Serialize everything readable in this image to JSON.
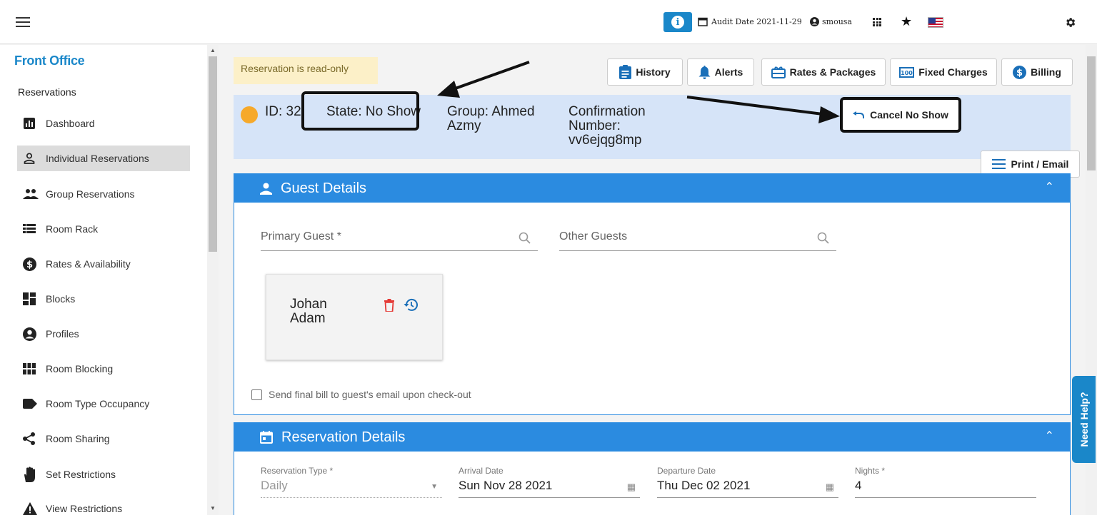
{
  "topbar": {
    "audit_label": "Audit Date 2021-11-29",
    "username": "smousa",
    "info_icon": "info-icon",
    "apps_icon": "apps-grid-icon",
    "favorites_icon": "star-icon",
    "language_icon": "us-flag-icon",
    "settings_icon": "gear-icon"
  },
  "sidebar": {
    "title": "Front Office",
    "section": "Reservations",
    "items": [
      {
        "label": "Dashboard",
        "icon": "dashboard-icon"
      },
      {
        "label": "Individual Reservations",
        "icon": "person-icon",
        "active": true
      },
      {
        "label": "Group Reservations",
        "icon": "group-icon"
      },
      {
        "label": "Room Rack",
        "icon": "list-icon"
      },
      {
        "label": "Rates & Availability",
        "icon": "dollar-icon"
      },
      {
        "label": "Blocks",
        "icon": "blocks-icon"
      },
      {
        "label": "Profiles",
        "icon": "profile-icon"
      },
      {
        "label": "Room Blocking",
        "icon": "grid-icon"
      },
      {
        "label": "Room Type Occupancy",
        "icon": "tag-icon"
      },
      {
        "label": "Room Sharing",
        "icon": "share-icon"
      },
      {
        "label": "Set Restrictions",
        "icon": "hand-icon"
      },
      {
        "label": "View Restrictions",
        "icon": "warning-icon"
      }
    ]
  },
  "main": {
    "readonly_notice": "Reservation is read-only",
    "toolbar": {
      "history": "History",
      "alerts": "Alerts",
      "rates_packages": "Rates & Packages",
      "fixed_charges": "Fixed Charges",
      "billing": "Billing"
    },
    "reservation": {
      "id": "ID: 32",
      "state": "State: No Show",
      "group_line1": "Group: Ahmed",
      "group_line2": "Azmy",
      "conf_line1": "Confirmation",
      "conf_line2": "Number:",
      "conf_line3": "vv6ejqg8mp",
      "cancel_no_show": "Cancel No Show",
      "print_email": "Print / Email"
    },
    "guest_details": {
      "title": "Guest Details",
      "primary_placeholder": "Primary Guest *",
      "other_placeholder": "Other Guests",
      "guest_first": "Johan",
      "guest_last": "Adam",
      "send_bill_label": "Send final bill to guest's email upon check-out"
    },
    "reservation_details": {
      "title": "Reservation Details",
      "type_label": "Reservation Type *",
      "type_value": "Daily",
      "arrival_label": "Arrival Date",
      "arrival_value": "Sun Nov 28 2021",
      "departure_label": "Departure Date",
      "departure_value": "Thu Dec 02 2021",
      "nights_label": "Nights *",
      "nights_value": "4"
    },
    "need_help": "Need Help?"
  },
  "colors": {
    "primary": "#2b8be0",
    "brand": "#1a87c9",
    "header_band": "#d6e4f8",
    "notice_bg": "#fcf0c8",
    "status_dot": "#f6a92b"
  }
}
